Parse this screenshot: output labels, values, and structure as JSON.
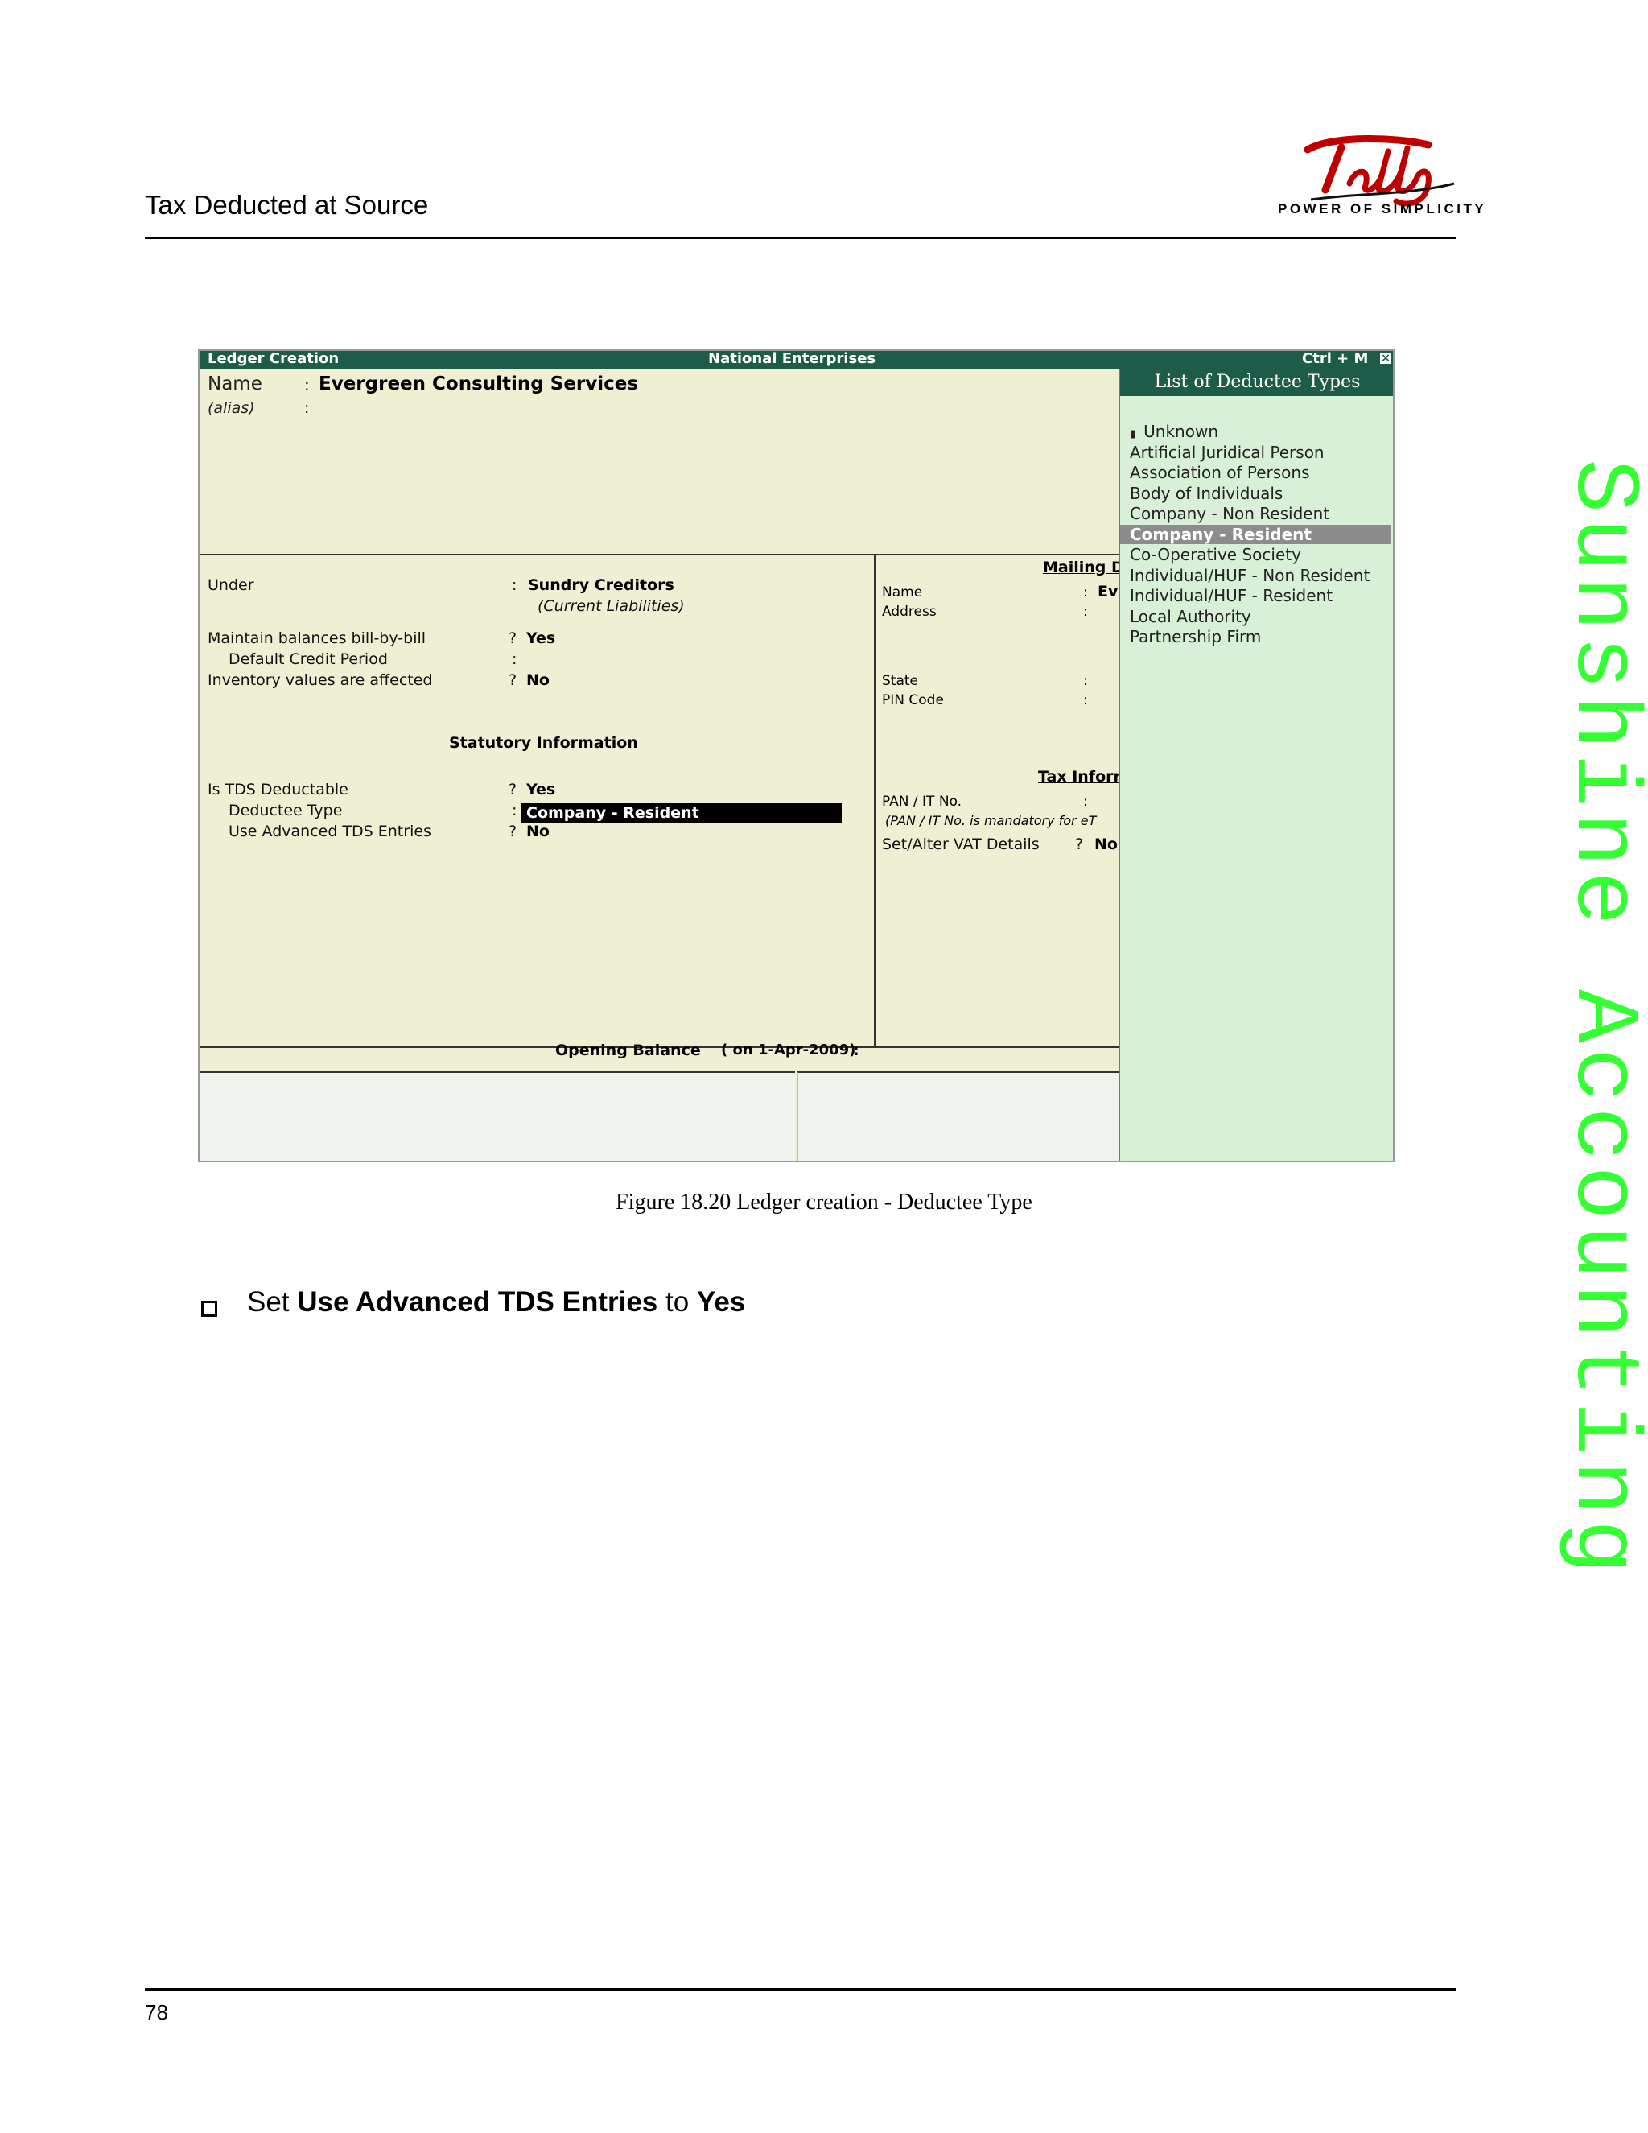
{
  "page": {
    "header_title": "Tax Deducted at Source",
    "logo_text": "Tally",
    "logo_tagline": "POWER OF SIMPLICITY",
    "page_number": "78",
    "watermark": "Sunshine Accounting"
  },
  "screen": {
    "titlebar": {
      "left": "Ledger Creation",
      "center": "National Enterprises",
      "right": "Ctrl + M",
      "close": "×"
    },
    "name_label": "Name",
    "name_colon": ":",
    "name_value": "Evergreen Consulting Services",
    "alias_label": "(alias)",
    "alias_colon": ":",
    "under_label": "Under",
    "under_colon": ":",
    "under_value": "Sundry Creditors",
    "under_sub": "(Current Liabilities)",
    "maintain_label": "Maintain balances bill-by-bill",
    "maintain_sep": "?",
    "maintain_value": "Yes",
    "credit_label": "Default Credit Period",
    "credit_sep": ":",
    "inventory_label": "Inventory values are affected",
    "inventory_sep": "?",
    "inventory_value": "No",
    "statutory_heading": "Statutory Information",
    "tds_label": "Is TDS Deductable",
    "tds_sep": "?",
    "tds_value": "Yes",
    "deductee_label": "Deductee Type",
    "deductee_sep": ":",
    "deductee_value": "Company - Resident",
    "advanced_label": "Use Advanced TDS Entries",
    "advanced_sep": "?",
    "advanced_value": "No",
    "mailing_heading": "Mailing D",
    "mail_name_label": "Name",
    "mail_name_sep": ":",
    "mail_name_value": "Ev",
    "address_label": "Address",
    "address_sep": ":",
    "state_label": "State",
    "state_sep": ":",
    "pin_label": "PIN Code",
    "pin_sep": ":",
    "tax_heading": "Tax Inforr",
    "pan_label": "PAN / IT No.",
    "pan_sep": ":",
    "pan_note": "(PAN / IT No. is mandatory for eT",
    "vat_label": "Set/Alter VAT Details",
    "vat_sep": "?",
    "vat_value": "No",
    "opening_label": "Opening Balance",
    "opening_date": "( on 1-Apr-2009)",
    "opening_colon": ":"
  },
  "list_panel": {
    "title": "List of Deductee Types",
    "items": [
      {
        "label": "Unknown",
        "marker": "▮"
      },
      {
        "label": "Artificial Juridical Person"
      },
      {
        "label": "Association of Persons"
      },
      {
        "label": "Body of Individuals"
      },
      {
        "label": "Company - Non Resident"
      },
      {
        "label": "Company - Resident",
        "selected": true
      },
      {
        "label": "Co-Operative Society"
      },
      {
        "label": "Individual/HUF - Non Resident"
      },
      {
        "label": "Individual/HUF - Resident"
      },
      {
        "label": "Local Authority"
      },
      {
        "label": "Partnership Firm"
      }
    ]
  },
  "caption": "Figure 18.20   Ledger creation - Deductee Type",
  "instruction": {
    "pre": "Set ",
    "bold1": "Use Advanced TDS Entries",
    "mid": " to ",
    "bold2": "Yes"
  }
}
